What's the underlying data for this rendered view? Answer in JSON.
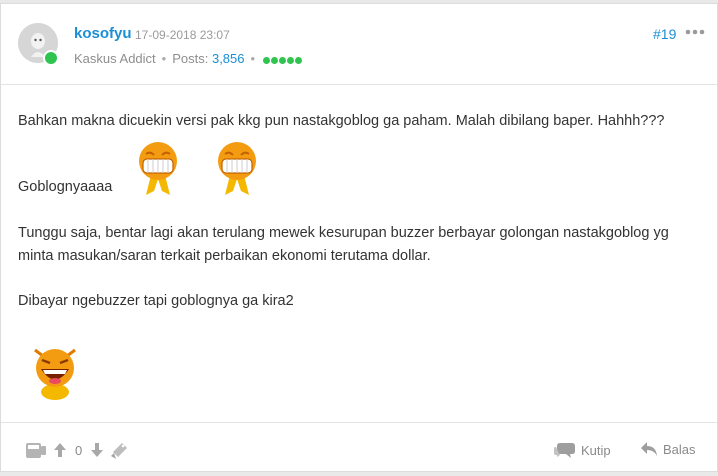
{
  "post": {
    "username": "kosofyu",
    "timestamp": "17-09-2018 23:07",
    "rank": "Kaskus Addict",
    "posts_label": "Posts:",
    "posts_count": "3,856",
    "post_number": "#19",
    "reputation_dots": 5
  },
  "body": {
    "p1": "Bahkan makna dicuekin versi pak kkg pun nastakgoblog ga paham. Malah dibilang baper. Hahhh???",
    "p2": "Goblognyaaaa",
    "p3_line1": "Tunggu saja, bentar lagi akan terulang mewek kesurupan buzzer berbayar golongan nastakgoblog yg",
    "p3_line2": "minta masukan/saran terkait perbaikan ekonomi terutama dollar.",
    "p4": "Dibayar ngebuzzer tapi goblognya ga kira2"
  },
  "emojis": [
    "grinning-emoticon",
    "grinning-emoticon",
    "laughing-emoticon"
  ],
  "footer": {
    "vote_count": "0",
    "quote_label": "Kutip",
    "reply_label": "Balas"
  },
  "colors": {
    "link": "#1b8fd6",
    "online": "#2ec44f",
    "emoji_orange": "#f39c12"
  }
}
